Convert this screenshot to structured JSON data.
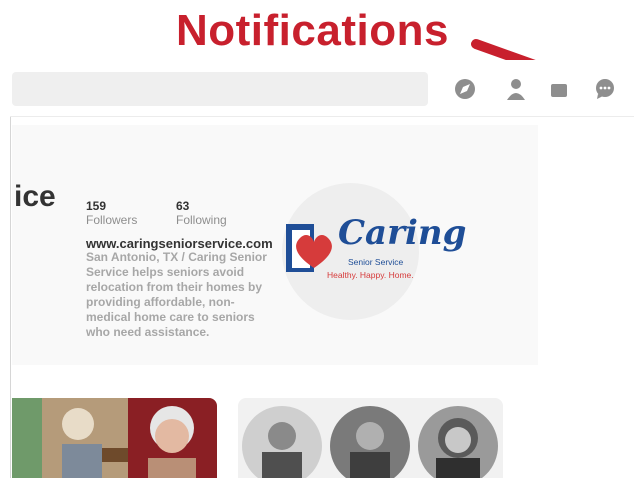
{
  "annotation": {
    "title": "Notifications",
    "color": "#c8202d"
  },
  "header": {
    "icons": [
      "explore-compass-icon",
      "profile-person-icon",
      "inbox-icon",
      "messages-chat-icon"
    ]
  },
  "profile": {
    "name_visible": "ice",
    "followers_count": "159",
    "followers_label": "Followers",
    "following_count": "63",
    "following_label": "Following",
    "website": "www.caringseniorservice.com",
    "bio": "San Antonio, TX / Caring Senior Service helps seniors avoid relocation from their homes by providing affordable, non-medical home care to seniors who need assistance."
  },
  "logo": {
    "name": "Caring",
    "subtitle": "Senior Service",
    "tagline": "Healthy. Happy. Home."
  }
}
